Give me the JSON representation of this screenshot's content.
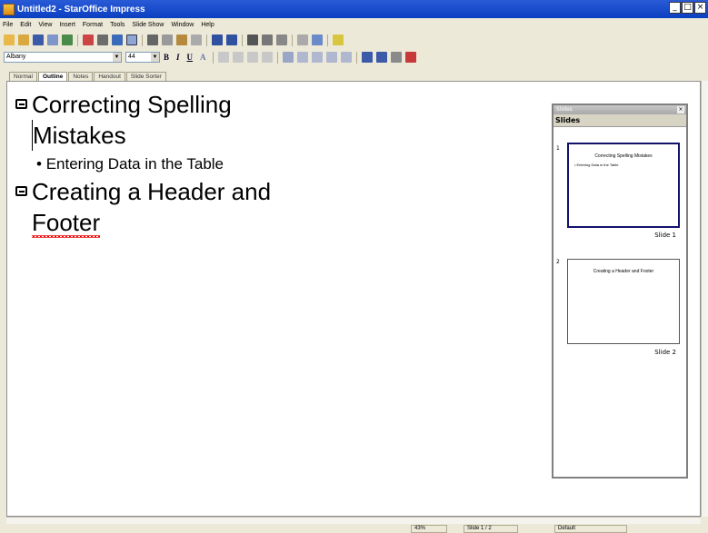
{
  "window": {
    "title": "Untitled2 - StarOffice Impress",
    "controls": [
      "_",
      "□",
      "×"
    ]
  },
  "menu": [
    "File",
    "Edit",
    "View",
    "Insert",
    "Format",
    "Tools",
    "Slide Show",
    "Window",
    "Help"
  ],
  "toolbar": {
    "font_name": "Albany",
    "font_size": "44",
    "bold": "B",
    "italic": "I",
    "underline": "U",
    "shadow": "A"
  },
  "tabs": [
    "Normal",
    "Outline",
    "Notes",
    "Handout",
    "Slide Sorter"
  ],
  "active_tab": "Outline",
  "outline": {
    "item1_line1": "Correcting Spelling",
    "item1_line2": "Mistakes",
    "sub1": "Entering Data in the Table",
    "item2_line1": "Creating a Header and",
    "item2_line2": "Footer"
  },
  "slides_panel": {
    "header": "Slides",
    "title": "Slides",
    "slides": [
      {
        "num": "1",
        "title": "Correcting Spelling Mistakes",
        "bullet": "• Entering Data in the Table",
        "label": "Slide 1"
      },
      {
        "num": "2",
        "title": "Creating a Header and Footer",
        "bullet": "",
        "label": "Slide 2"
      }
    ]
  },
  "status": {
    "zoom": "43%",
    "slide": "Slide 1 / 2",
    "layout": "Default"
  },
  "colors": {
    "titlebar": "#0a3fc0",
    "selected_slide": "#12126b",
    "spell_underline": "#e00000"
  }
}
